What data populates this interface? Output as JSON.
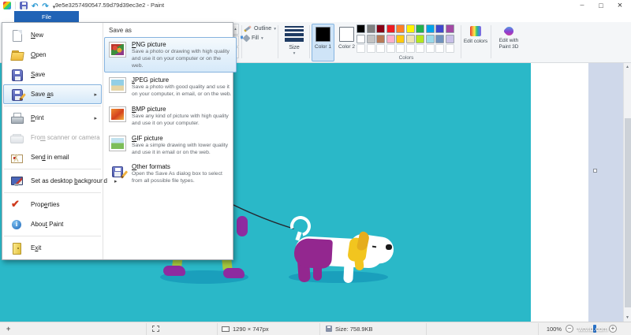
{
  "titlebar": {
    "title": "9e5e3257490547.59d79d39ec3e2 - Paint"
  },
  "tabs": {
    "file": "File"
  },
  "ribbon": {
    "outline_label": "Outline",
    "fill_label": "Fill",
    "size_label": "Size",
    "color1_label": "Color 1",
    "color2_label": "Color 2",
    "colors_group_label": "Colors",
    "edit_colors_label": "Edit colors",
    "edit_paint3d_label": "Edit with Paint 3D",
    "palette_row1": [
      "#000000",
      "#7f7f7f",
      "#880015",
      "#ed1c24",
      "#ff7f27",
      "#fff200",
      "#22b14c",
      "#00a2e8",
      "#3f48cc",
      "#a349a4"
    ],
    "palette_row2": [
      "#ffffff",
      "#c3c3c3",
      "#b97a57",
      "#ffaec9",
      "#ffc90e",
      "#efe4b0",
      "#b5e61d",
      "#99d9ea",
      "#7092be",
      "#c8bfe7"
    ],
    "palette_empty_slots": 10
  },
  "file_menu": {
    "items": [
      {
        "label": "New",
        "accel": 0,
        "icon": "new-document"
      },
      {
        "label": "Open",
        "accel": 0,
        "icon": "open-folder"
      },
      {
        "label": "Save",
        "accel": 0,
        "icon": "save-floppy"
      },
      {
        "label": "Save as",
        "accel": 5,
        "icon": "save-as-floppy",
        "submenu": true,
        "highlighted": true
      },
      {
        "separator": true
      },
      {
        "label": "Print",
        "accel": 0,
        "icon": "printer",
        "submenu": true
      },
      {
        "label": "From scanner or camera",
        "accel": 3,
        "icon": "scanner",
        "disabled": true
      },
      {
        "label": "Send in email",
        "accel": 3,
        "icon": "email"
      },
      {
        "separator": true
      },
      {
        "label": "Set as desktop background",
        "accel": 15,
        "icon": "desktop-background",
        "submenu": true
      },
      {
        "separator": true
      },
      {
        "label": "Properties",
        "accel": 4,
        "icon": "properties-check"
      },
      {
        "label": "About Paint",
        "accel": 4,
        "icon": "about-info"
      },
      {
        "separator": true
      },
      {
        "label": "Exit",
        "accel": 1,
        "icon": "exit-door"
      }
    ]
  },
  "save_as_submenu": {
    "header": "Save as",
    "items": [
      {
        "title": "PNG picture",
        "accel": 0,
        "icon": "png-picture",
        "description": "Save a photo or drawing with high quality and use it on your computer or on the web.",
        "highlighted": true
      },
      {
        "title": "JPEG picture",
        "accel": 0,
        "icon": "jpeg-picture",
        "description": "Save a photo with good quality and use it on your computer, in email, or on the web."
      },
      {
        "title": "BMP picture",
        "accel": 0,
        "icon": "bmp-picture",
        "description": "Save any kind of picture with high quality and use it on your computer."
      },
      {
        "title": "GIF picture",
        "accel": 0,
        "icon": "gif-picture",
        "description": "Save a simple drawing with lower quality and use it in email or on the web."
      },
      {
        "title": "Other formats",
        "accel": 0,
        "icon": "other-formats",
        "description": "Open the Save As dialog box to select from all possible file types."
      }
    ]
  },
  "statusbar": {
    "canvas_size": "1290 × 747px",
    "file_size": "Size: 758.9KB",
    "zoom_level": "100%"
  },
  "watermark": "wtvid.com",
  "colors": {
    "file_tab_blue": "#2063b6",
    "canvas_teal": "#2ab8c8",
    "canvas_shadow": "#1a9fbc",
    "dog_purple": "#93278f",
    "scarf_yellow": "#f2c51f",
    "leg_green": "#a6c93f",
    "shoe_purple": "#8e2ba0",
    "leash": "#26262e",
    "menu_highlight": "#d6e9f9",
    "color1_value": "#000000",
    "color2_value": "#ffffff"
  }
}
